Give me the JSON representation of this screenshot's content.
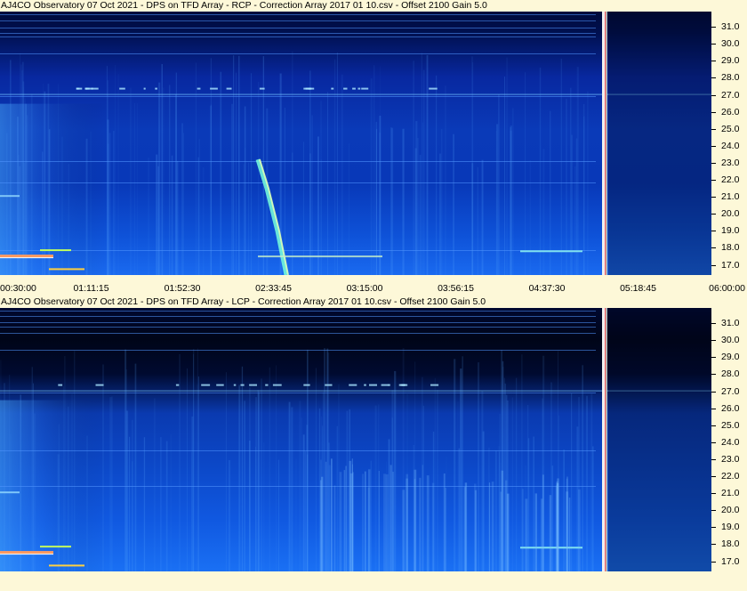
{
  "panels": [
    {
      "id": "rcp",
      "title": "AJ4CO Observatory 07 Oct 2021  -  DPS on TFD Array  -  RCP  -  Correction Array 2017 01 10.csv  -  Offset 2100  Gain 5.0"
    },
    {
      "id": "lcp",
      "title": "AJ4CO Observatory 07 Oct 2021  -  DPS on TFD Array  -  LCP  -  Correction Array 2017 01 10.csv  -  Offset 2100  Gain 5.0"
    }
  ],
  "chart_data": [
    {
      "type": "heatmap",
      "title": "AJ4CO Observatory 07 Oct 2021  -  DPS on TFD Array  -  RCP  -  Correction Array 2017 01 10.csv  -  Offset 2100  Gain 5.0",
      "polarization": "RCP",
      "x_ticks": [
        "00:30:00",
        "01:11:15",
        "01:52:30",
        "02:33:45",
        "03:15:00",
        "03:56:15",
        "04:37:30",
        "05:18:45",
        "06:00:00"
      ],
      "y_ticks": [
        "31.0",
        "30.0",
        "29.0",
        "28.0",
        "27.0",
        "26.0",
        "25.0",
        "24.0",
        "23.0",
        "22.0",
        "21.0",
        "20.0",
        "19.0",
        "18.0",
        "17.0"
      ],
      "ylim": [
        16.4,
        31.9
      ],
      "colors": {
        "low": "#000820",
        "mid": "#0a3fd0",
        "high": "#40b8ff",
        "peak": "#ffffff"
      }
    },
    {
      "type": "heatmap",
      "title": "AJ4CO Observatory 07 Oct 2021  -  DPS on TFD Array  -  LCP  -  Correction Array 2017 01 10.csv  -  Offset 2100  Gain 5.0",
      "polarization": "LCP",
      "x_ticks": [],
      "y_ticks": [
        "31.0",
        "30.0",
        "29.0",
        "28.0",
        "27.0",
        "26.0",
        "25.0",
        "24.0",
        "23.0",
        "22.0",
        "21.0",
        "20.0",
        "19.0",
        "18.0",
        "17.0"
      ],
      "ylim": [
        16.4,
        31.9
      ],
      "colors": {
        "low": "#000510",
        "mid": "#0a3fd0",
        "high": "#40b8ff",
        "peak": "#ffffff"
      }
    }
  ]
}
